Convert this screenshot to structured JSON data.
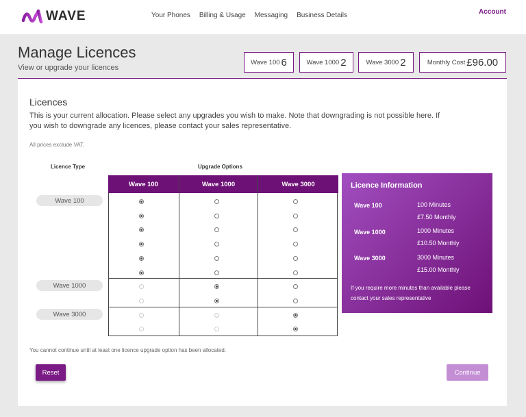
{
  "header": {
    "logo_text": "WAVE",
    "nav": [
      "Your Phones",
      "Billing & Usage",
      "Messaging",
      "Business Details"
    ],
    "account": "Account"
  },
  "page": {
    "title": "Manage Licences",
    "subtitle": "View or upgrade your licences"
  },
  "stats": [
    {
      "label": "Wave 100",
      "value": "6"
    },
    {
      "label": "Wave 1000",
      "value": "2"
    },
    {
      "label": "Wave 3000",
      "value": "2"
    },
    {
      "label": "Monthly Cost",
      "value": "£96.00"
    }
  ],
  "licences": {
    "title": "Licences",
    "description": "This is your current allocation. Please select any upgrades you wish to make. Note that downgrading is not possible here. If you wish to downgrade any licences, please contact your sales representative.",
    "vat_note": "All prices exclude VAT.",
    "col_type": "Licence Type",
    "col_options": "Upgrade Options",
    "headers": [
      "Wave 100",
      "Wave 1000",
      "Wave 3000"
    ],
    "groups": [
      {
        "type": "Wave 100",
        "rows": [
          0,
          0,
          0,
          0,
          0,
          0
        ]
      },
      {
        "type": "Wave 1000",
        "rows": [
          1,
          1
        ]
      },
      {
        "type": "Wave 3000",
        "rows": [
          2,
          2
        ]
      }
    ]
  },
  "info": {
    "title": "Licence Information",
    "items": [
      {
        "name": "Wave 100",
        "minutes": "100 Minutes",
        "price": "£7.50 Monthly"
      },
      {
        "name": "Wave 1000",
        "minutes": "1000 Minutes",
        "price": "£10.50 Monthly"
      },
      {
        "name": "Wave 3000",
        "minutes": "3000 Minutes",
        "price": "£15.00 Monthly"
      }
    ],
    "note": "If you require more minutes than available please contact your sales representative"
  },
  "footer": {
    "warning": "You cannot continue until at least one licence upgrade option has been allocated.",
    "reset": "Reset",
    "continue": "Continue"
  },
  "colors": {
    "brand": "#7a1a84",
    "header_bg": "#6e1177"
  }
}
